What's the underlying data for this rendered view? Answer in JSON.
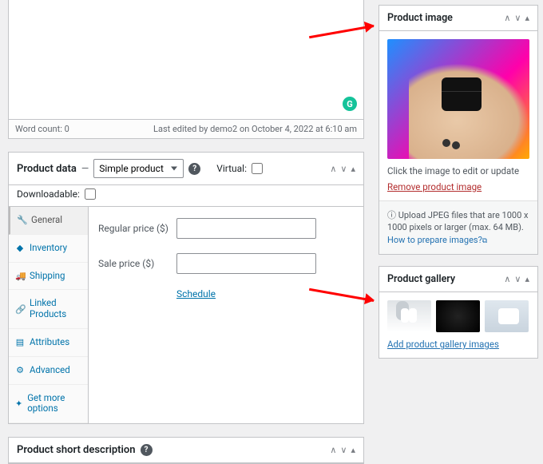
{
  "editor": {
    "word_count": "Word count: 0",
    "last_edited": "Last edited by demo2 on October 4, 2022 at 6:10 am",
    "grammarly": "G"
  },
  "product_data": {
    "title": "Product data",
    "dash": "—",
    "product_type": "Simple product",
    "virtual_label": "Virtual:",
    "downloadable_label": "Downloadable:",
    "tabs": {
      "general": "General",
      "inventory": "Inventory",
      "shipping": "Shipping",
      "linked": "Linked Products",
      "attributes": "Attributes",
      "advanced": "Advanced",
      "getmore": "Get more options"
    },
    "fields": {
      "regular_price": "Regular price ($)",
      "sale_price": "Sale price ($)",
      "schedule": "Schedule"
    }
  },
  "short_desc": {
    "title": "Product short description"
  },
  "product_image": {
    "title": "Product image",
    "click_hint": "Click the image to edit or update",
    "remove": "Remove product image",
    "upload_note_pre": "Upload JPEG files that are 1000 x 1000 pixels or larger (max. 64 MB). ",
    "howto": "How to prepare images?",
    "info_glyph": "ⓘ",
    "ext_glyph": "⧉"
  },
  "product_gallery": {
    "title": "Product gallery",
    "add": "Add product gallery images"
  },
  "toggle": {
    "up": "∧",
    "down": "∨",
    "tri": "▴"
  },
  "help_glyph": "?"
}
